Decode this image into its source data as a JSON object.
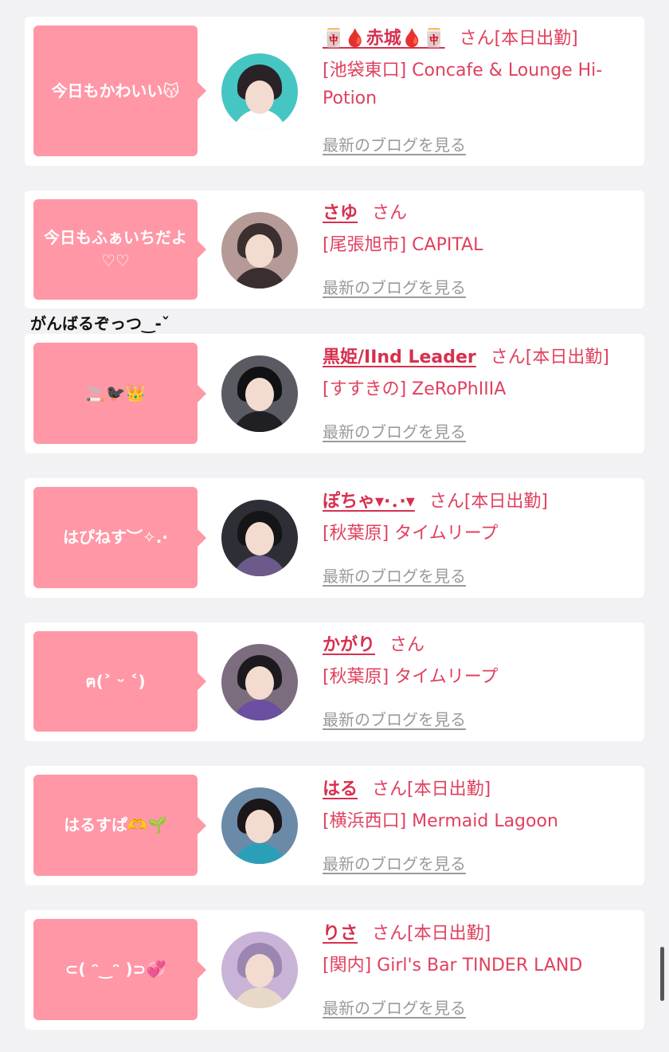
{
  "entries": [
    {
      "comment": "今日もかわいい😽",
      "name": "🀄🩸赤城🩸🀄",
      "honorific": "さん",
      "status": "[本日出勤]",
      "shop": "[池袋東口] Concafe & Lounge Hi-Potion",
      "blog_link": "最新のブログを見る",
      "avatar_bg": "#46c6c2"
    },
    {
      "comment": "今日もふぁいちだよ♡♡",
      "name": "さゆ",
      "honorific": "さん",
      "status": "",
      "shop": "[尾張旭市] CAPITAL",
      "blog_link": "最新のブログを見る",
      "avatar_bg": "#b59a98"
    },
    {
      "comment": "🚬🐦‍⬛👑",
      "name": "黒姫/IInd Leader",
      "honorific": "さん",
      "status": "[本日出勤]",
      "shop": "[すすきの] ZeRoPhIIIA",
      "blog_link": "最新のブログを見る",
      "avatar_bg": "#5a5a62"
    },
    {
      "comment": "はぴねす︶✧.·",
      "name": "ぽちゃ▾·．·▾",
      "honorific": "さん",
      "status": "[本日出勤]",
      "shop": "[秋葉原] タイムリープ",
      "blog_link": "最新のブログを見る",
      "avatar_bg": "#2e2f36"
    },
    {
      "comment": "ฅ(˃ ᵕ ˂)",
      "name": "かがり",
      "honorific": "さん",
      "status": "",
      "shop": "[秋葉原] タイムリープ",
      "blog_link": "最新のブログを見る",
      "avatar_bg": "#7c6d7e"
    },
    {
      "comment": "はるすぱ🫶🌱",
      "name": "はる",
      "honorific": "さん",
      "status": "[本日出勤]",
      "shop": "[横浜西口] Mermaid Lagoon",
      "blog_link": "最新のブログを見る",
      "avatar_bg": "#6a8aa8"
    },
    {
      "comment": "⊂( ᵔ‿ᵔ )⊃💞",
      "name": "りさ",
      "honorific": "さん",
      "status": "[本日出勤]",
      "shop": "[関内] Girl's Bar TINDER LAND",
      "blog_link": "最新のブログを見る",
      "avatar_bg": "#c9b3d6"
    }
  ],
  "overflow_text": "がんばるぞっつ‿-ˇ",
  "colors": {
    "bubble": "#ff97a6",
    "name": "#d6304f",
    "text": "#e0405e",
    "link": "#9a9a9a",
    "background": "#f2f2f4"
  }
}
